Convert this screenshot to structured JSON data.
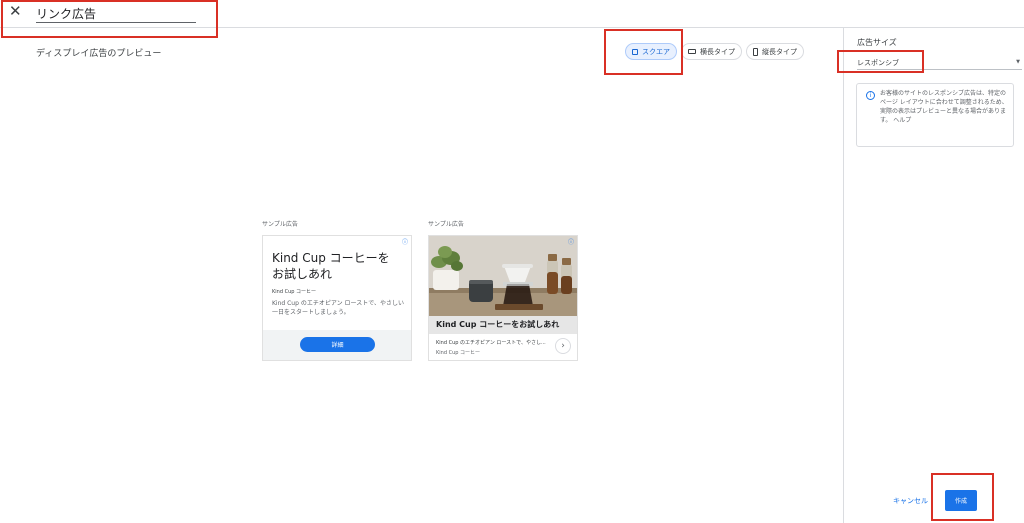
{
  "header": {
    "close_icon": "close-icon",
    "title_value": "リンク広告"
  },
  "preview": {
    "label": "ディスプレイ広告のプレビュー",
    "toggles": [
      {
        "label": "スクエア",
        "icon": "square-icon",
        "selected": true
      },
      {
        "label": "横長タイプ",
        "icon": "landscape-icon",
        "selected": false
      },
      {
        "label": "縦長タイプ",
        "icon": "portrait-icon",
        "selected": false
      }
    ]
  },
  "ads": [
    {
      "caption": "サンプル広告",
      "headline": "Kind Cup コーヒーを お試しあれ",
      "brand": "Kind Cup コーヒー",
      "description": "Kind Cup のエチオピアン ローストで、やさしい一日をスタートしましょう。",
      "cta": "詳細",
      "info_icon": "ⓘ"
    },
    {
      "caption": "サンプル広告",
      "headline": "Kind Cup コーヒーをお試しあれ",
      "description": "Kind Cup のエチオピアン ローストで、やさし...",
      "brand": "Kind Cup コーヒー",
      "info_icon": "ⓘ",
      "arrow": "›"
    }
  ],
  "sidebar": {
    "size_label": "広告サイズ",
    "size_value": "レスポンシブ",
    "info_text": "お客様のサイトのレスポンシブ広告は、特定のページ レイアウトに合わせて調整されるため、実際の表示はプレビューと異なる場合があります。 ヘルプ"
  },
  "actions": {
    "cancel_label": "キャンセル",
    "create_label": "作成"
  },
  "colors": {
    "accent": "#1a73e8",
    "highlight": "#d93025"
  }
}
